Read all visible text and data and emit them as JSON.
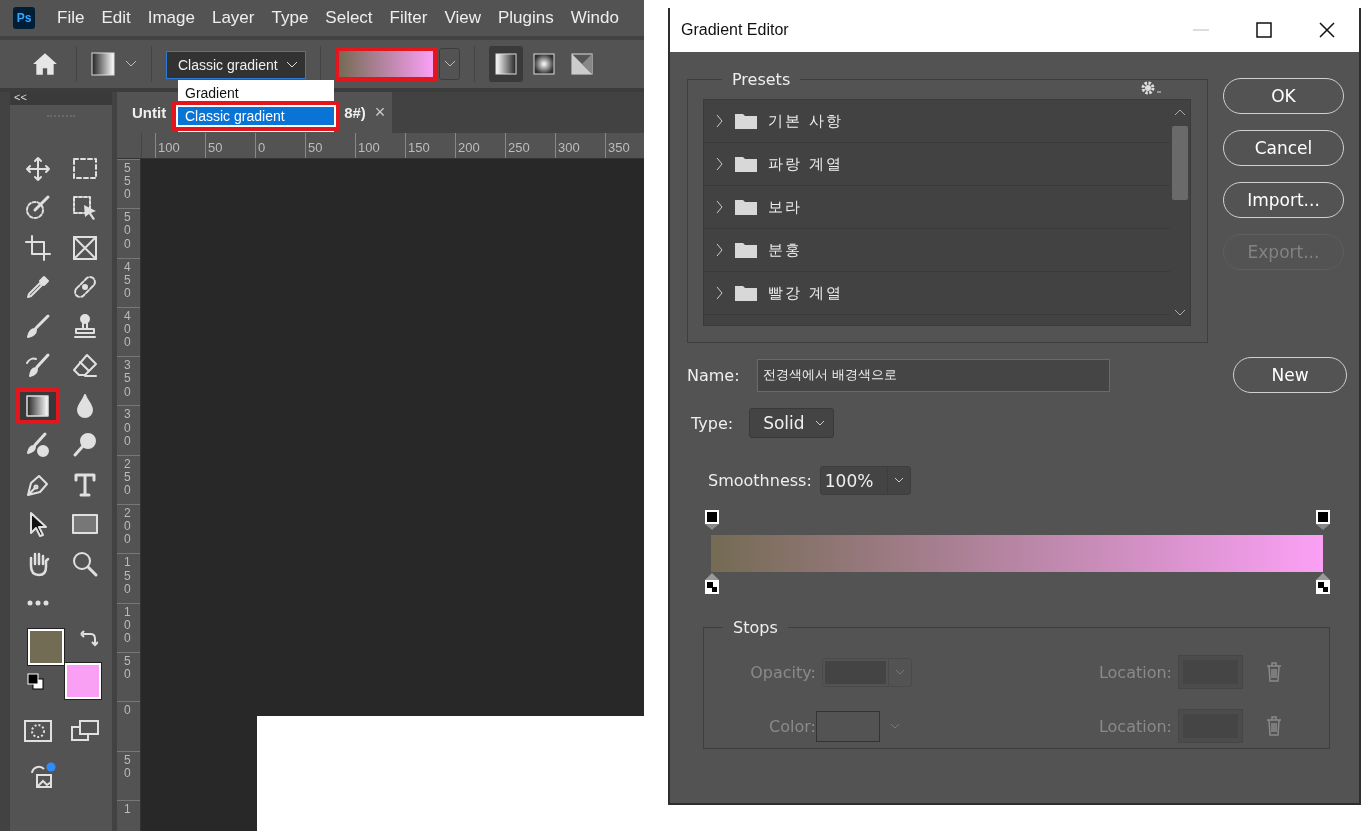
{
  "app_logo": "Ps",
  "menu_bar": {
    "items": [
      "File",
      "Edit",
      "Image",
      "Layer",
      "Type",
      "Select",
      "Filter",
      "View",
      "Plugins",
      "Windo"
    ]
  },
  "options_bar": {
    "mode_select": {
      "value": "Classic gradient"
    },
    "gradient_preview": {
      "highlighted": true
    },
    "gradient_types": [
      {
        "kind": "linear",
        "selected": true
      },
      {
        "kind": "radial",
        "selected": false
      },
      {
        "kind": "angle",
        "selected": false
      }
    ]
  },
  "mode_menu": {
    "options": [
      {
        "label": "Gradient",
        "selected": false,
        "highlighted": false
      },
      {
        "label": "Classic gradient",
        "selected": true,
        "highlighted": true
      }
    ]
  },
  "toolbar": {
    "collapse": "<<",
    "tools": [
      {
        "kind": "move",
        "selected": false,
        "highlighted": false
      },
      {
        "kind": "marquee",
        "selected": false,
        "highlighted": false
      },
      {
        "kind": "quick-select",
        "selected": false,
        "highlighted": false
      },
      {
        "kind": "object-select",
        "selected": false,
        "highlighted": false
      },
      {
        "kind": "crop",
        "selected": false,
        "highlighted": false
      },
      {
        "kind": "frame",
        "selected": false,
        "highlighted": false
      },
      {
        "kind": "eyedropper",
        "selected": false,
        "highlighted": false
      },
      {
        "kind": "healing",
        "selected": false,
        "highlighted": false
      },
      {
        "kind": "brush",
        "selected": false,
        "highlighted": false
      },
      {
        "kind": "stamp",
        "selected": false,
        "highlighted": false
      },
      {
        "kind": "history-brush",
        "selected": false,
        "highlighted": false
      },
      {
        "kind": "eraser",
        "selected": false,
        "highlighted": false
      },
      {
        "kind": "gradient",
        "selected": true,
        "highlighted": true
      },
      {
        "kind": "blur",
        "selected": false,
        "highlighted": false
      },
      {
        "kind": "color-replace",
        "selected": false,
        "highlighted": false
      },
      {
        "kind": "dodge",
        "selected": false,
        "highlighted": false
      },
      {
        "kind": "pen",
        "selected": false,
        "highlighted": false
      },
      {
        "kind": "type",
        "selected": false,
        "highlighted": false
      },
      {
        "kind": "path-select",
        "selected": false,
        "highlighted": false
      },
      {
        "kind": "rectangle",
        "selected": false,
        "highlighted": false
      },
      {
        "kind": "hand",
        "selected": false,
        "highlighted": false
      },
      {
        "kind": "zoom",
        "selected": false,
        "highlighted": false
      },
      {
        "kind": "more",
        "selected": false,
        "highlighted": false
      }
    ],
    "color_swatches": [
      {
        "kind": "foreground",
        "color": "#736c55"
      },
      {
        "kind": "background",
        "color": "#f9a0f5"
      }
    ]
  },
  "document_tab": {
    "title_start": "Untit",
    "title_end": "8#)",
    "close": "×"
  },
  "rulers": {
    "horizontal": [
      "100",
      "50",
      "0",
      "50",
      "100",
      "150",
      "200",
      "250",
      "300",
      "350"
    ],
    "vertical": [
      "550",
      "500",
      "450",
      "400",
      "350",
      "300",
      "250",
      "200",
      "150",
      "100",
      "50",
      "0",
      "50",
      "1"
    ]
  },
  "dialog": {
    "title": "Gradient Editor",
    "presets": {
      "label": "Presets",
      "folders": [
        {
          "name": "기본 사항",
          "expanded": false
        },
        {
          "name": "파랑 계열",
          "expanded": false
        },
        {
          "name": "보라",
          "expanded": false
        },
        {
          "name": "분홍",
          "expanded": false
        },
        {
          "name": "빨강 계열",
          "expanded": false
        }
      ]
    },
    "buttons": [
      {
        "label": "OK",
        "disabled": false
      },
      {
        "label": "Cancel",
        "disabled": false
      },
      {
        "label": "Import...",
        "disabled": false
      },
      {
        "label": "Export...",
        "disabled": true
      }
    ],
    "name": {
      "label": "Name:",
      "value": "전경색에서 배경색으로"
    },
    "new_button": "New",
    "type": {
      "label": "Type:",
      "value": "Solid"
    },
    "smoothness": {
      "label": "Smoothness:",
      "value": "100%"
    },
    "gradient": {
      "color_stops": [
        {
          "color": "#746b53"
        },
        {
          "color": "#fba0f5"
        }
      ]
    },
    "stops": {
      "label": "Stops",
      "rows": [
        {
          "label": "Opacity:",
          "kind": "dropdown",
          "location": "Location:"
        },
        {
          "label": "Color:",
          "kind": "swatch",
          "location": "Location:"
        }
      ],
      "disabled": true
    }
  }
}
